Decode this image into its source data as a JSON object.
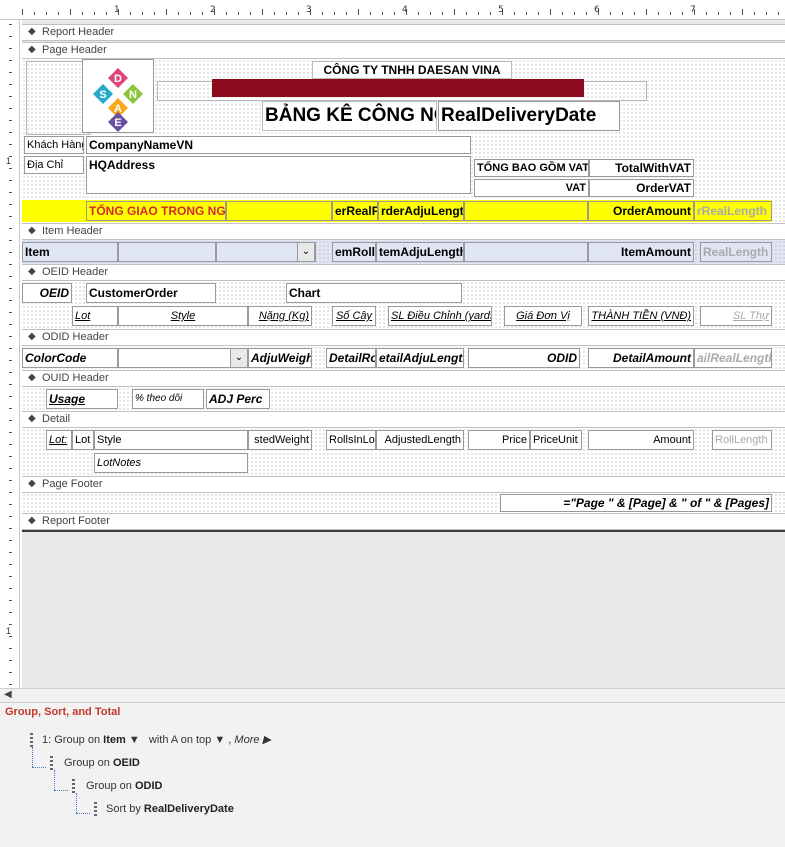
{
  "ruler": {
    "numbers": [
      "1",
      "2",
      "3",
      "4",
      "5",
      "6",
      "7"
    ],
    "left_numbers": [
      "1",
      "1"
    ]
  },
  "bands": {
    "report_header": "Report Header",
    "page_header": "Page Header",
    "item_header": "Item Header",
    "oeid_header": "OEID Header",
    "odid_header": "ODID Header",
    "ouid_header": "OUID Header",
    "detail": "Detail",
    "page_footer": "Page Footer",
    "report_footer": "Report Footer"
  },
  "page_header": {
    "logo_letters": [
      "D",
      "S",
      "A",
      "N",
      "E"
    ],
    "company_title": "CÔNG TY TNHH DAESAN VINA",
    "report_title": "BẢNG KÊ CÔNG NỢ",
    "date_field": "RealDeliveryDate",
    "lbl_customer": "Khách Hàng",
    "val_customer": "CompanyNameVN",
    "lbl_address": "Địa Chỉ",
    "val_address": "HQAddress",
    "lbl_total_vat": "TỔNG BAO GỒM VAT",
    "val_total_vat": "TotalWithVAT",
    "lbl_vat": "VAT",
    "val_vat": "OrderVAT",
    "lbl_total_day": "TỔNG GIAO TRONG NGÀY",
    "f_real": "erRealF",
    "f_adju": "rderAdjuLength",
    "f_amount": "OrderAmount",
    "f_real_len": "rRealLength",
    "accent": "#8b0a1e",
    "highlight": "#ffff00"
  },
  "item_header": {
    "item": "Item",
    "roll": "emRoll",
    "adju": "temAdjuLength",
    "amount": "ItemAmount",
    "real": "RealLength"
  },
  "oeid_header": {
    "oeid": "OEID",
    "customer_order": "CustomerOrder",
    "chart": "Chart",
    "col_lot": "Lot",
    "col_style": "Style",
    "col_weight": "Nặng (Kg)",
    "col_rolls": "Số Cây",
    "col_adjusted": "SL Điều Chỉnh (yards)",
    "col_unit_price": "Giá Đơn Vị",
    "col_amount": "THÀNH TIỀN (VNĐ)",
    "col_sl_thuc": "SL Thự"
  },
  "odid_header": {
    "color_code": "ColorCode",
    "adju_weight": "AdjuWeight",
    "detail_roll": "DetailRol",
    "detail_adju": "etailAdjuLength",
    "odid": "ODID",
    "detail_amount": "DetailAmount",
    "real_length": "ailRealLength"
  },
  "ouid_header": {
    "usage": "Usage",
    "theo_doi": "% theo dõi",
    "adj_perc": "ADJ Perc"
  },
  "detail": {
    "lbl_lot": "Lot:",
    "lot": "Lot",
    "style": "Style",
    "weight": "stedWeight",
    "rolls": "RollsInLot",
    "adjusted": "AdjustedLength",
    "price": "Price",
    "price_unit": "PriceUnit",
    "amount": "Amount",
    "roll_length": "RollLength",
    "lot_notes": "LotNotes"
  },
  "page_footer": {
    "page_expr": "=\"Page \" & [Page] & \" of \" & [Pages]"
  },
  "gst": {
    "title": "Group, Sort, and Total",
    "row1_prefix": "1:  Group on",
    "row1_field": "Item",
    "row1_sort": "with A on top",
    "row1_more": "More ▶",
    "row2_prefix": "Group on",
    "row2_field": "OEID",
    "row3_prefix": "Group on",
    "row3_field": "ODID",
    "row4_prefix": "Sort by",
    "row4_field": "RealDeliveryDate"
  }
}
